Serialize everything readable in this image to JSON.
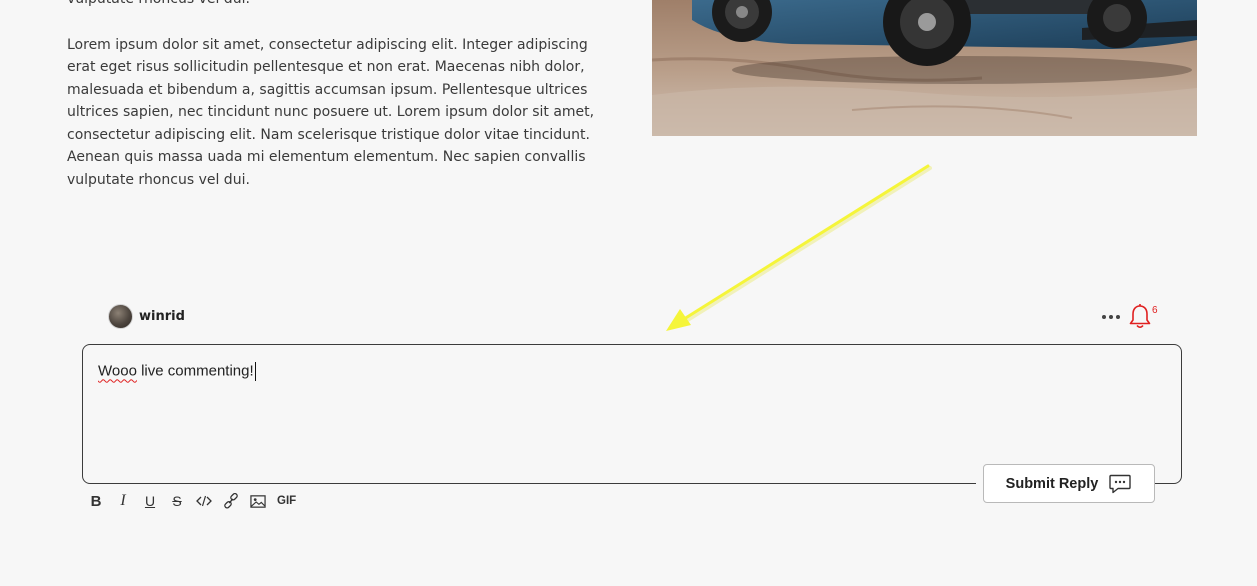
{
  "article": {
    "paragraph_1_tail": "vulputate rhoncus vel dui.",
    "paragraph_2": "Lorem ipsum dolor sit amet, consectetur adipiscing elit. Integer adipiscing erat eget risus sollicitudin pellentesque et non erat. Maecenas nibh dolor, malesuada et bibendum a, sagittis accumsan ipsum. Pellentesque ultrices ultrices sapien, nec tincidunt nunc posuere ut. Lorem ipsum dolor sit amet, consectetur adipiscing elit. Nam scelerisque tristique dolor vitae tincidunt. Aenean quis massa uada mi elementum elementum. Nec sapien convallis vulputate rhoncus vel dui."
  },
  "photo": {
    "subject": "blue SUV on rocky desert terrain"
  },
  "annotation": {
    "arrow_color": "#f5f53a"
  },
  "comment": {
    "username": "winrid",
    "notification_count": "6",
    "reply_text_misspelled": "Wooo",
    "reply_text_rest": " live commenting!",
    "submit_label": "Submit Reply"
  },
  "toolbar": {
    "bold": "B",
    "italic": "I",
    "underline": "U",
    "strike": "S",
    "gif": "GIF"
  },
  "icons": {
    "more": "more-horizontal-icon",
    "bell": "bell-icon",
    "chat": "chat-bubble-icon",
    "code": "code-icon",
    "link": "link-icon",
    "image": "image-icon"
  },
  "colors": {
    "accent_red": "#e02020",
    "background": "#f7f7f7",
    "border": "#3c3c3c"
  }
}
